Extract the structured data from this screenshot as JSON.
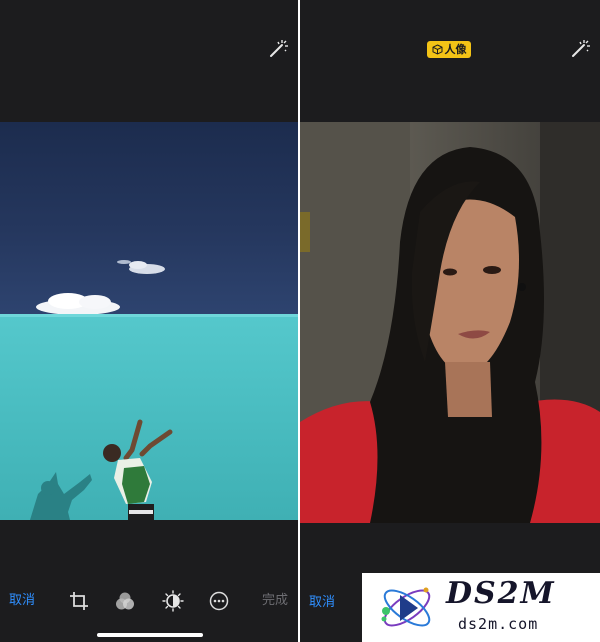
{
  "left_editor": {
    "cancel_label": "取消",
    "done_label": "完成",
    "tools": [
      "crop-rotate-icon",
      "filters-icon",
      "adjust-icon",
      "more-icon"
    ],
    "magic_icon": "magic-wand-icon"
  },
  "right_editor": {
    "portrait_badge": "人像",
    "cancel_label": "取消",
    "magic_icon": "magic-wand-icon",
    "lighting_options": [
      "natural-light",
      "studio-light",
      "contour-light",
      "stage-light",
      "stage-light-mono"
    ]
  },
  "watermark": {
    "main": "DS2M",
    "sub": "ds2m.com"
  },
  "colors": {
    "background": "#1c1c1e",
    "accent_blue": "#2f8fff",
    "badge_yellow": "#f3c316",
    "done_gray": "#6d6d72"
  }
}
